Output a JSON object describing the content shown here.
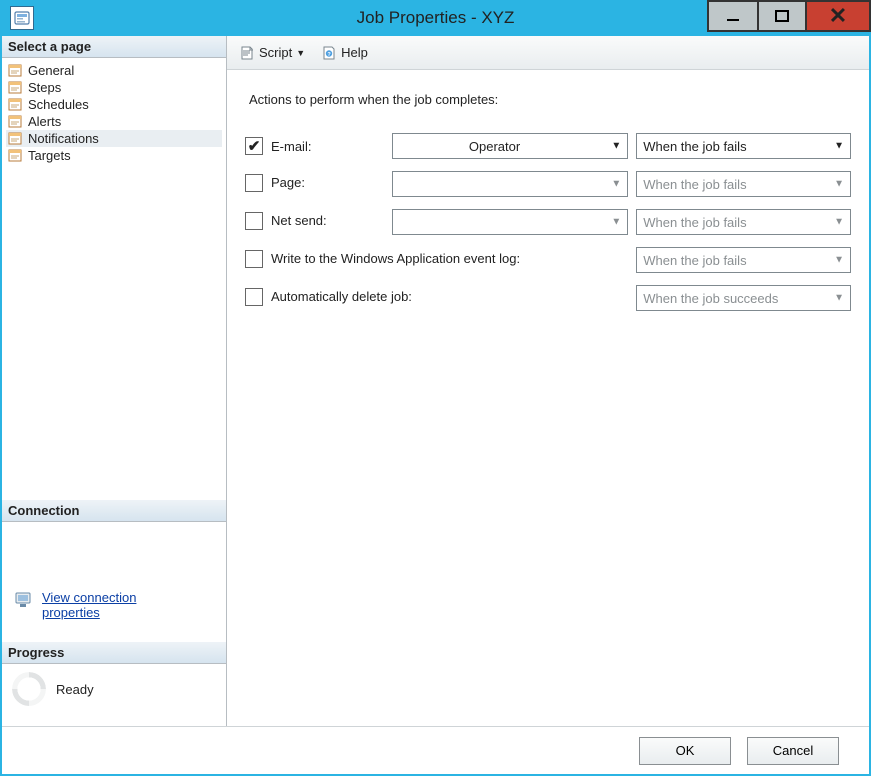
{
  "window": {
    "title": "Job Properties - XYZ"
  },
  "sidebar": {
    "header": "Select a page",
    "items": [
      {
        "label": "General"
      },
      {
        "label": "Steps"
      },
      {
        "label": "Schedules"
      },
      {
        "label": "Alerts"
      },
      {
        "label": "Notifications"
      },
      {
        "label": "Targets"
      }
    ],
    "selected_index": 4
  },
  "connection": {
    "header": "Connection",
    "view_link_line1": "View connection",
    "view_link_line2": "properties"
  },
  "progress": {
    "header": "Progress",
    "status": "Ready"
  },
  "toolbar": {
    "script_label": "Script",
    "help_label": "Help"
  },
  "notifications": {
    "heading": "Actions to perform when the job completes:",
    "rows": {
      "email": {
        "label": "E-mail:",
        "checked": true,
        "operator_visible": true,
        "operator": "Operator",
        "condition": "When the job fails",
        "enabled": true
      },
      "page": {
        "label": "Page:",
        "checked": false,
        "operator_visible": true,
        "operator": "",
        "condition": "When the job fails",
        "enabled": false
      },
      "netsend": {
        "label": "Net send:",
        "checked": false,
        "operator_visible": true,
        "operator": "",
        "condition": "When the job fails",
        "enabled": false
      },
      "evtlog": {
        "label": "Write to the Windows Application event log:",
        "checked": false,
        "operator_visible": false,
        "condition": "When the job fails",
        "enabled": false
      },
      "autodel": {
        "label": "Automatically delete job:",
        "checked": false,
        "operator_visible": false,
        "condition": "When the job succeeds",
        "enabled": false
      }
    }
  },
  "buttons": {
    "ok": "OK",
    "cancel": "Cancel"
  }
}
